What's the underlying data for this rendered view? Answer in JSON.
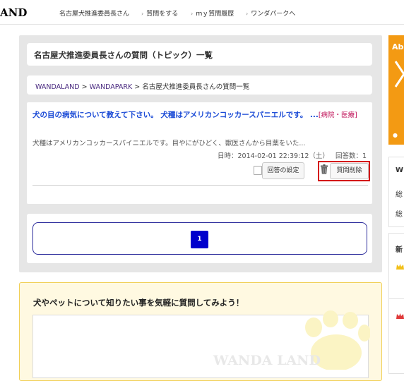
{
  "header": {
    "logo": "AND",
    "user_label": "名古屋犬推進委員長さん",
    "nav": [
      "質問をする",
      "ｍｙ質問履歴",
      "ワンダパークへ"
    ]
  },
  "page_title": "名古屋犬推進委員長さんの質問（トピック）一覧",
  "breadcrumb": {
    "items": [
      "WANDALAND",
      "WANDAPARK"
    ],
    "separator": ">",
    "current": "名古屋犬推進委員長さんの質問一覧"
  },
  "question": {
    "title": "犬の目の病気について教えて下さい。 犬種はアメリカンコッカースパニエルです。 ...",
    "category": "[病院・医療]",
    "excerpt": "犬種はアメリカンコッカースパイニエルです。目やにがひどく、獣医さんから目薬をいた...",
    "datetime_label": "日時：2014-02-01 22:39:12（土）",
    "answers_label": "回答数：1",
    "settings_button": "回答の設定",
    "delete_button": "質問削除",
    "checkbox_checked": false
  },
  "pagination": {
    "current_page": "1"
  },
  "ask": {
    "prompt": "犬やペットについて知りたい事を気軽に質問してみよう！",
    "watermark": "WANDA LAND"
  },
  "sidebar": {
    "banner_text": "Ab",
    "box1_title": "W",
    "box1_row1": "総",
    "box1_row2": "総",
    "box2_title": "新"
  },
  "colors": {
    "accent_orange": "#f39a13",
    "link_blue": "#1a4ad6",
    "category_red": "#c0145a",
    "highlight_red": "#d40000",
    "pager_blue": "#0000cc",
    "ask_bg": "#fff9e1"
  },
  "icons": [
    "trash-icon",
    "paw-icon",
    "crown-icon",
    "arrow-icon"
  ]
}
